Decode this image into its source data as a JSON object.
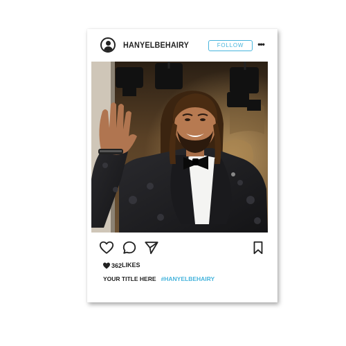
{
  "post": {
    "username": "HANYELBEHAIRY",
    "follow_label": "FOLLOW",
    "more_label": "•••",
    "likes_count": "362",
    "likes_suffix": "LIKES",
    "caption_title": "YOUR TITLE HERE",
    "hashtag": "#HANYELBEHAIRY"
  },
  "icons": {
    "avatar": "user-avatar-icon",
    "like": "heart-outline-icon",
    "comment": "comment-bubble-icon",
    "share": "paper-plane-icon",
    "save": "bookmark-icon",
    "likes_heart": "heart-filled-icon"
  },
  "colors": {
    "accent": "#46b4dc",
    "text": "#222222",
    "background": "#ffffff"
  },
  "photo": {
    "subject": "man in black jacquard tuxedo with bow tie, waving, stage lights above"
  }
}
